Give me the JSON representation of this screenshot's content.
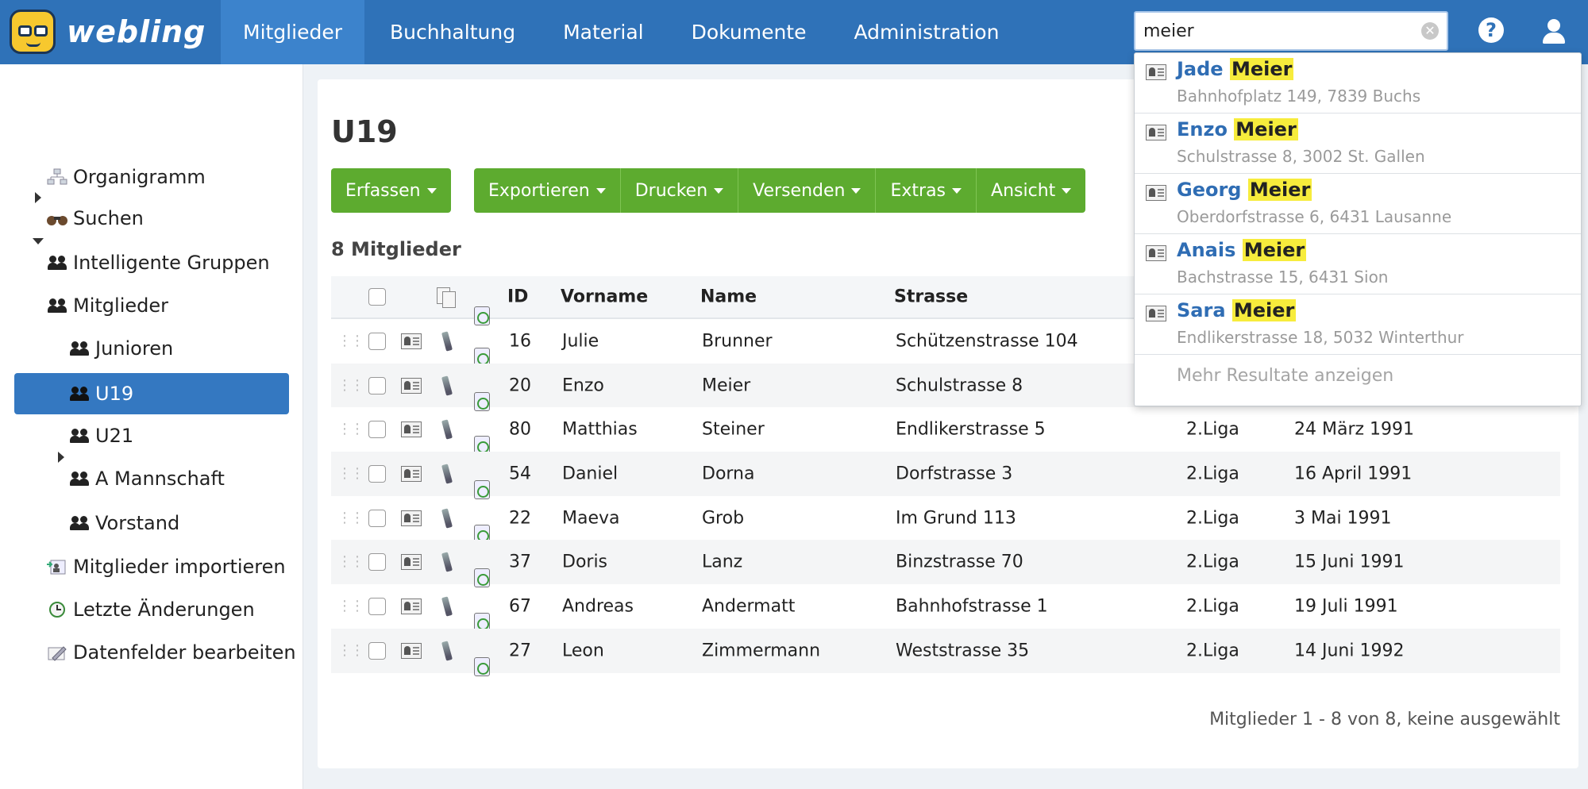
{
  "app": {
    "logo_text": "webling"
  },
  "nav": [
    {
      "label": "Mitglieder",
      "active": true
    },
    {
      "label": "Buchhaltung"
    },
    {
      "label": "Material"
    },
    {
      "label": "Dokumente"
    },
    {
      "label": "Administration"
    }
  ],
  "search": {
    "value": "meier",
    "clear": "✕"
  },
  "help_label": "?",
  "sidebar": {
    "items": [
      {
        "label": "Organigramm",
        "icon": "org-chart-icon"
      },
      {
        "label": "Suchen",
        "icon": "binoculars-icon"
      },
      {
        "label": "Intelligente Gruppen",
        "icon": "smart-group-icon"
      },
      {
        "label": "Mitglieder",
        "icon": "group-icon"
      },
      {
        "label": "Junioren",
        "icon": "group-icon"
      },
      {
        "label": "U19",
        "icon": "group-icon",
        "active": true
      },
      {
        "label": "U21",
        "icon": "group-icon"
      },
      {
        "label": "A Mannschaft",
        "icon": "group-icon"
      },
      {
        "label": "Vorstand",
        "icon": "group-icon"
      },
      {
        "label": "Mitglieder importieren",
        "icon": "import-icon"
      },
      {
        "label": "Letzte Änderungen",
        "icon": "history-icon"
      },
      {
        "label": "Datenfelder bearbeiten",
        "icon": "edit-fields-icon"
      }
    ]
  },
  "main": {
    "title": "U19",
    "toolbar": {
      "erfassen": "Erfassen",
      "exportieren": "Exportieren",
      "drucken": "Drucken",
      "versenden": "Versenden",
      "extras": "Extras",
      "ansicht": "Ansicht"
    },
    "count_label": "8 Mitglieder",
    "table": {
      "headers": {
        "id": "ID",
        "vorname": "Vorname",
        "name": "Name",
        "strasse": "Strasse"
      },
      "rows": [
        {
          "id": "16",
          "vorname": "Julie",
          "name": "Brunner",
          "strasse": "Schützenstrasse 104",
          "liga": "",
          "datum": ""
        },
        {
          "id": "20",
          "vorname": "Enzo",
          "name": "Meier",
          "strasse": "Schulstrasse 8",
          "liga": "",
          "datum": ""
        },
        {
          "id": "80",
          "vorname": "Matthias",
          "name": "Steiner",
          "strasse": "Endlikerstrasse 5",
          "liga": "2.Liga",
          "datum": "24 März 1991"
        },
        {
          "id": "54",
          "vorname": "Daniel",
          "name": "Dorna",
          "strasse": "Dorfstrasse 3",
          "liga": "2.Liga",
          "datum": "16 April 1991"
        },
        {
          "id": "22",
          "vorname": "Maeva",
          "name": "Grob",
          "strasse": "Im Grund 113",
          "liga": "2.Liga",
          "datum": "3 Mai 1991"
        },
        {
          "id": "37",
          "vorname": "Doris",
          "name": "Lanz",
          "strasse": "Binzstrasse 70",
          "liga": "2.Liga",
          "datum": "15 Juni 1991"
        },
        {
          "id": "67",
          "vorname": "Andreas",
          "name": "Andermatt",
          "strasse": "Bahnhofstrasse 1",
          "liga": "2.Liga",
          "datum": "19 Juli 1991"
        },
        {
          "id": "27",
          "vorname": "Leon",
          "name": "Zimmermann",
          "strasse": "Weststrasse 35",
          "liga": "2.Liga",
          "datum": "14 Juni 1992"
        }
      ]
    },
    "footer": "Mitglieder 1 - 8 von 8, keine ausgewählt"
  },
  "search_results": {
    "items": [
      {
        "first": "Jade",
        "last": "Meier",
        "address": "Bahnhofplatz 149, 7839 Buchs"
      },
      {
        "first": "Enzo",
        "last": "Meier",
        "address": "Schulstrasse 8, 3002 St. Gallen"
      },
      {
        "first": "Georg",
        "last": "Meier",
        "address": "Oberdorfstrasse 6, 6431 Lausanne"
      },
      {
        "first": "Anais",
        "last": "Meier",
        "address": "Bachstrasse 15, 6431 Sion"
      },
      {
        "first": "Sara",
        "last": "Meier",
        "address": "Endlikerstrasse 18, 5032 Winterthur"
      }
    ],
    "more": "Mehr Resultate anzeigen"
  },
  "colors": {
    "topbar": "#2f72b8",
    "accent_green": "#5dab2f",
    "highlight": "#f7ec3c",
    "selected": "#3478c1"
  }
}
